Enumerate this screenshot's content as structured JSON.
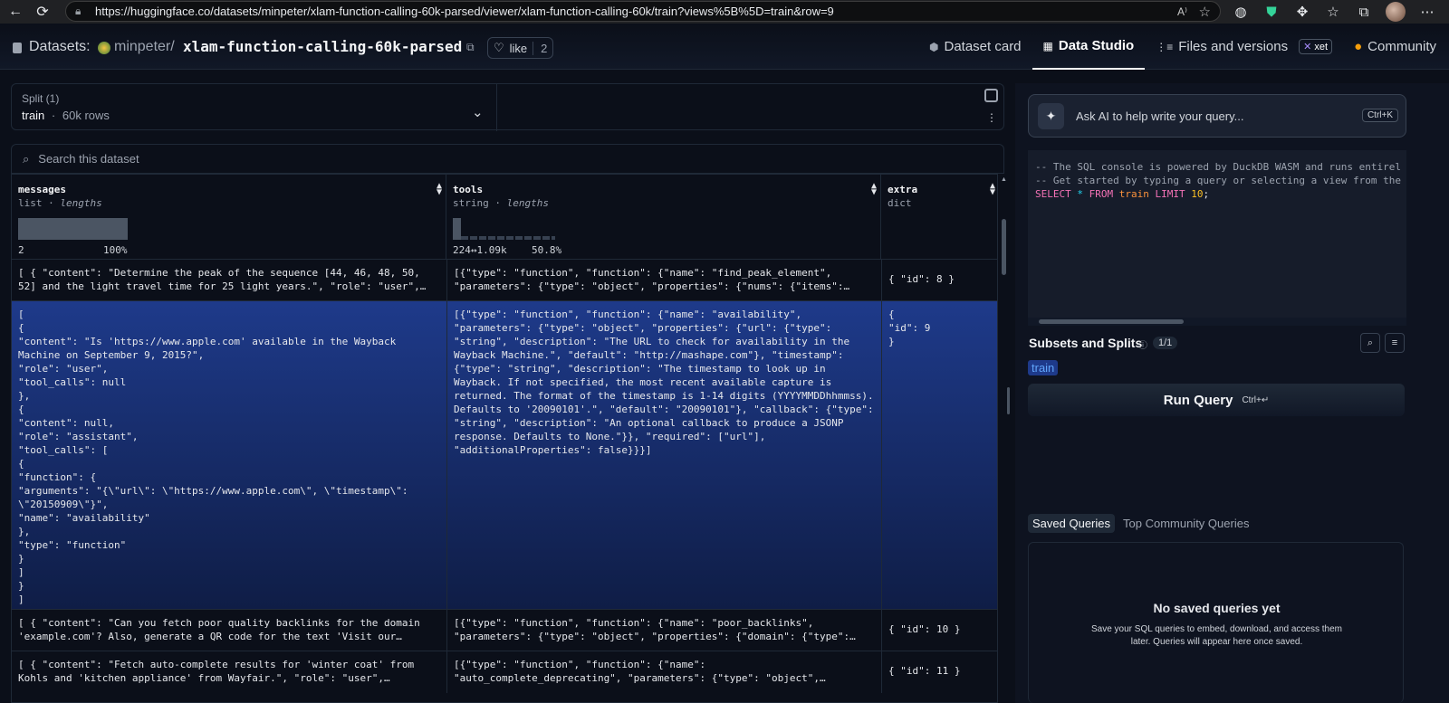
{
  "browser": {
    "url": "https://huggingface.co/datasets/minpeter/xlam-function-calling-60k-parsed/viewer/xlam-function-calling-60k/train?views%5B%5D=train&row=9"
  },
  "header": {
    "datasets_label": "Datasets:",
    "owner": "minpeter",
    "separator": "/",
    "repo": "xlam-function-calling-60k-parsed",
    "like_label": "like",
    "like_count": "2",
    "tabs": [
      {
        "label": "Dataset card",
        "icon": "cube-icon"
      },
      {
        "label": "Data Studio",
        "icon": "table-icon",
        "active": true
      },
      {
        "label": "Files and versions",
        "icon": "files-icon",
        "badge": "xet"
      },
      {
        "label": "Community",
        "icon": "hf-icon"
      }
    ]
  },
  "split": {
    "label": "Split (1)",
    "name": "train",
    "sep": "·",
    "rows": "60k rows"
  },
  "search": {
    "placeholder": "Search this dataset"
  },
  "columns": [
    {
      "name": "messages",
      "type": "list",
      "stat": "lengths",
      "hist_left": "2",
      "hist_right": "100%"
    },
    {
      "name": "tools",
      "type": "string",
      "stat": "lengths",
      "hist_left": "224↔1.09k",
      "hist_right": "50.8%"
    },
    {
      "name": "extra",
      "type": "dict",
      "stat": ""
    }
  ],
  "rows": [
    {
      "messages": "[ { \"content\": \"Determine the peak of the sequence [44, 46, 48, 50, 52] and the light travel time for 25 light years.\", \"role\": \"user\",…",
      "tools": "[{\"type\": \"function\", \"function\": {\"name\": \"find_peak_element\", \"parameters\": {\"type\": \"object\", \"properties\": {\"nums\": {\"items\":…",
      "extra": "{ \"id\": 8 }"
    },
    {
      "messages": "[\n{\n\"content\": \"Is 'https://www.apple.com' available in the Wayback Machine on September 9, 2015?\",\n\"role\": \"user\",\n\"tool_calls\": null\n},\n{\n\"content\": null,\n\"role\": \"assistant\",\n\"tool_calls\": [\n{\n\"function\": {\n\"arguments\": \"{\\\"url\\\": \\\"https://www.apple.com\\\", \\\"timestamp\\\": \\\"20150909\\\"}\",\n\"name\": \"availability\"\n},\n\"type\": \"function\"\n}\n]\n}\n]",
      "tools": "[{\"type\": \"function\", \"function\": {\"name\": \"availability\", \"parameters\": {\"type\": \"object\", \"properties\": {\"url\": {\"type\": \"string\", \"description\": \"The URL to check for availability in the Wayback Machine.\", \"default\": \"http://mashape.com\"}, \"timestamp\": {\"type\": \"string\", \"description\": \"The timestamp to look up in Wayback. If not specified, the most recent available capture is returned. The format of the timestamp is 1-14 digits (YYYYMMDDhhmmss). Defaults to '20090101'.\", \"default\": \"20090101\"}, \"callback\": {\"type\": \"string\", \"description\": \"An optional callback to produce a JSONP response. Defaults to None.\"}}, \"required\": [\"url\"], \"additionalProperties\": false}}}]",
      "extra": "{\n\"id\": 9\n}"
    },
    {
      "messages": "[ { \"content\": \"Can you fetch poor quality backlinks for the domain 'example.com'? Also, generate a QR code for the text 'Visit our…",
      "tools": "[{\"type\": \"function\", \"function\": {\"name\": \"poor_backlinks\", \"parameters\": {\"type\": \"object\", \"properties\": {\"domain\": {\"type\":…",
      "extra": "{ \"id\": 10 }"
    },
    {
      "messages": "[ { \"content\": \"Fetch auto-complete results for 'winter coat' from Kohls and 'kitchen appliance' from Wayfair.\", \"role\": \"user\",…",
      "tools": "[{\"type\": \"function\", \"function\": {\"name\": \"auto_complete_deprecating\", \"parameters\": {\"type\": \"object\",…",
      "extra": "{ \"id\": 11 }"
    }
  ],
  "ai": {
    "placeholder": "Ask AI to help write your query...",
    "shortcut": "Ctrl+K"
  },
  "sql": {
    "comment1": "-- The SQL console is powered by DuckDB WASM and runs entirel",
    "comment2": "-- Get started by typing a query or selecting a view from the",
    "kw_select": "SELECT",
    "star": "*",
    "kw_from": "FROM",
    "table": "train",
    "kw_limit": "LIMIT",
    "limit": "10",
    "semi": ";"
  },
  "subsets": {
    "title": "Subsets and Splits",
    "count": "1/1",
    "chip": "train"
  },
  "run": {
    "label": "Run Query",
    "shortcut": "Ctrl+↵"
  },
  "queries": {
    "tab_saved": "Saved Queries",
    "tab_top": "Top Community Queries",
    "empty_title": "No saved queries yet",
    "empty_sub": "Save your SQL queries to embed, download, and access them later. Queries will appear here once saved."
  }
}
